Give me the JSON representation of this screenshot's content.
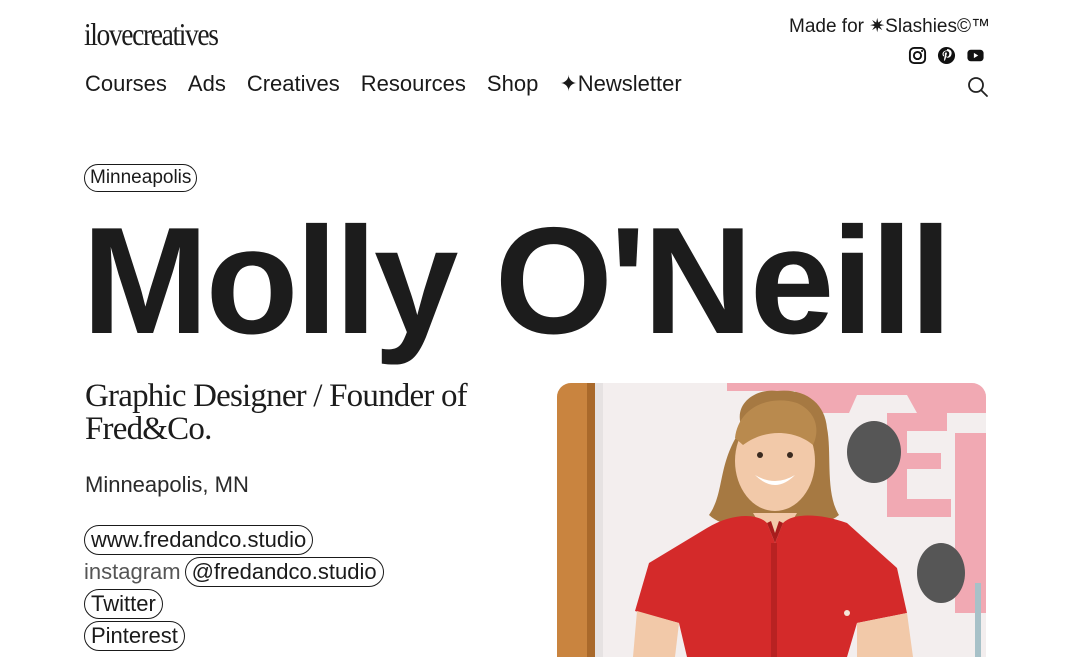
{
  "header": {
    "logo": "ilovecreatives",
    "tagline": "Made for ✷Slashies©™",
    "socials": [
      "instagram-icon",
      "pinterest-icon",
      "youtube-icon"
    ]
  },
  "nav": {
    "items": [
      {
        "label": "Courses"
      },
      {
        "label": "Ads"
      },
      {
        "label": "Creatives"
      },
      {
        "label": "Resources"
      },
      {
        "label": "Shop"
      },
      {
        "label": "✦Newsletter"
      }
    ],
    "search_icon": "search-icon"
  },
  "profile": {
    "city_tag": "Minneapolis",
    "name": "Molly O'Neill",
    "role": "Graphic Designer / Founder of Fred&Co.",
    "location": "Minneapolis, MN",
    "website": "www.fredandco.studio",
    "instagram_label": "instagram",
    "instagram_handle": "@fredandco.studio",
    "twitter": "Twitter",
    "pinterest": "Pinterest"
  },
  "colors": {
    "text": "#1a1a1a",
    "background": "#ffffff",
    "shirt": "#d42a2a",
    "wall_letters": "#f1a9b3"
  }
}
